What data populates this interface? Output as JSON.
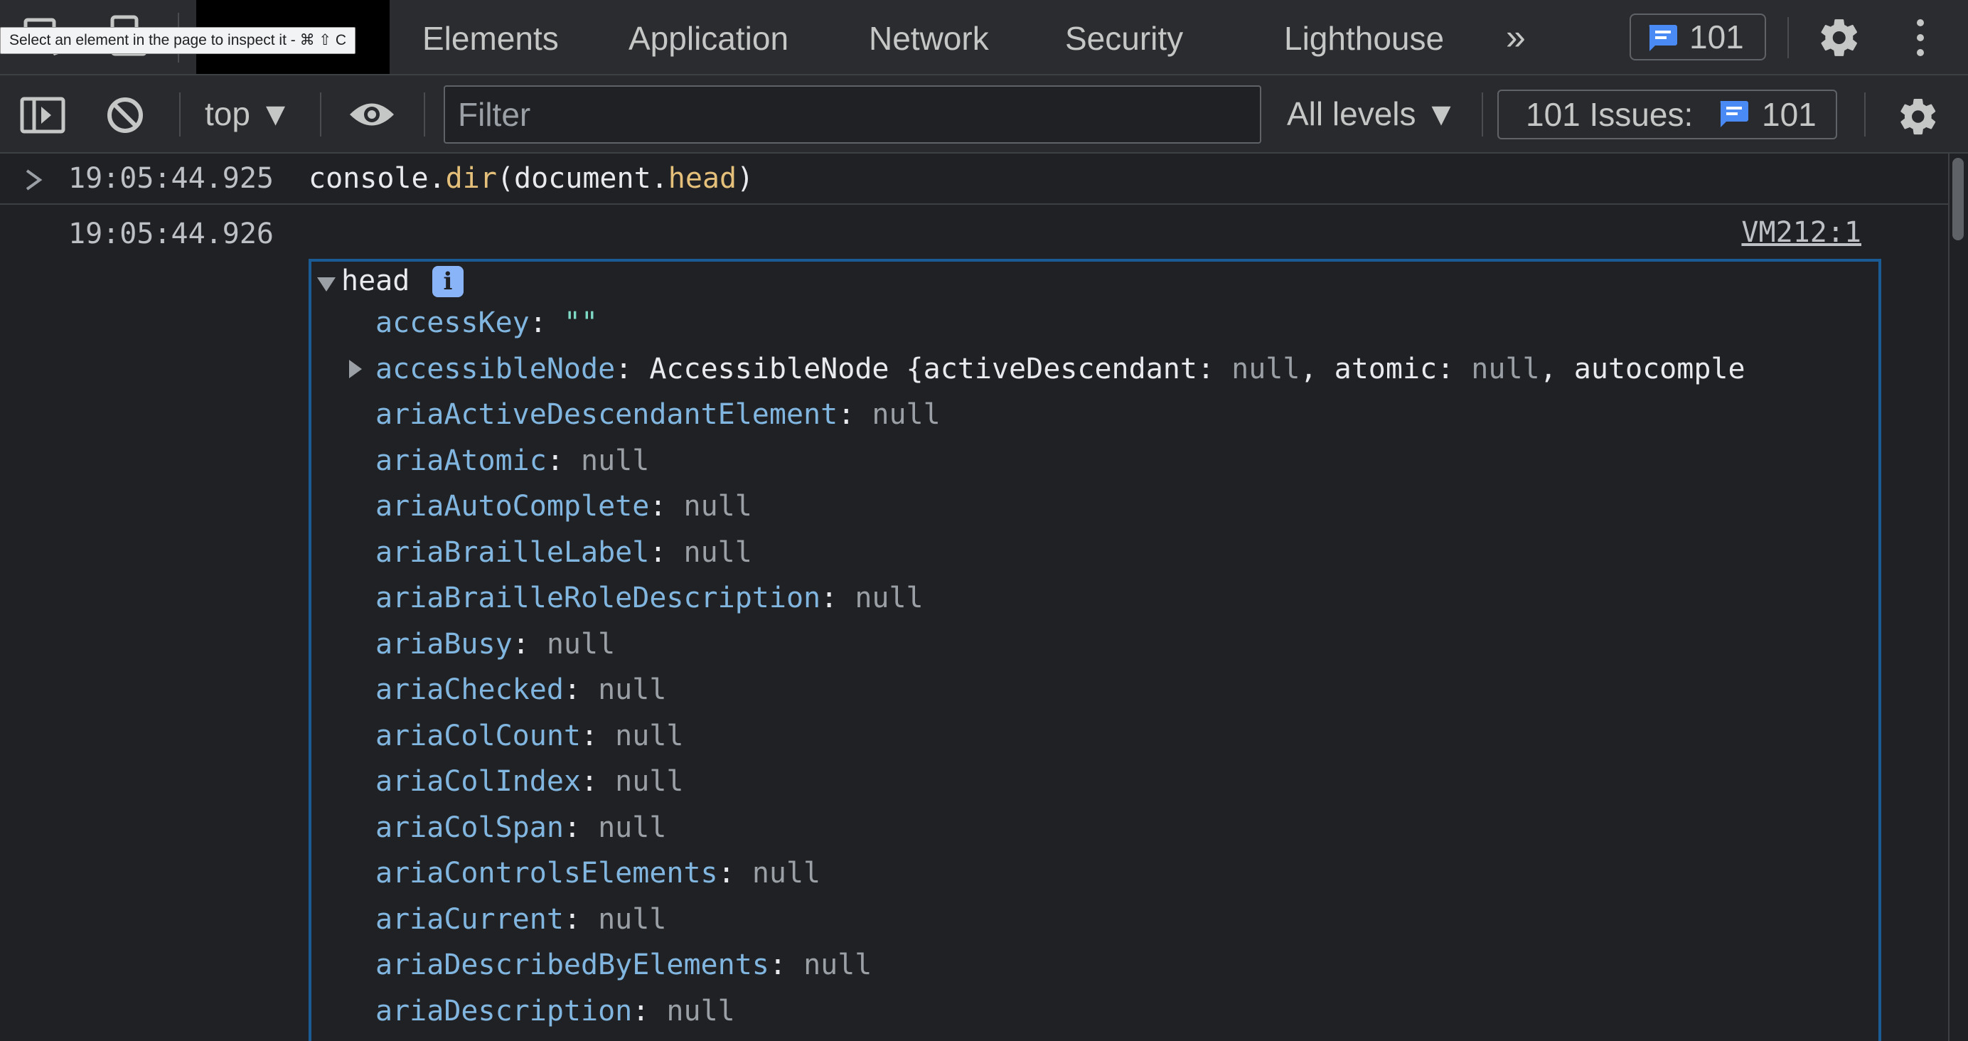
{
  "tooltip": {
    "text": "Select an element in the page to inspect it - ⌘ ⇧ C"
  },
  "tabs": [
    {
      "label": "Elements"
    },
    {
      "label": "Application"
    },
    {
      "label": "Network"
    },
    {
      "label": "Security"
    },
    {
      "label": "Lighthouse"
    }
  ],
  "tabbar": {
    "more_tabs": "»",
    "issues_count": "101"
  },
  "toolbar": {
    "context": "top ▼",
    "filter_placeholder": "Filter",
    "levels": "All levels ▼",
    "issues_label": "101 Issues:",
    "issues_count": "101"
  },
  "console": {
    "input": {
      "timestamp": "19:05:44.925",
      "cmd_pre": "console.",
      "cmd_fn": "dir",
      "cmd_mid": "(document.",
      "cmd_prop": "head",
      "cmd_end": ")"
    },
    "output": {
      "timestamp": "19:05:44.926",
      "source": "VM212:1",
      "object_name": "head",
      "info_badge": "i",
      "properties": [
        {
          "key": "accessKey",
          "value": "\"\"",
          "kind": "string"
        },
        {
          "key": "accessibleNode",
          "value": "AccessibleNode {activeDescendant: null, atomic: null, autocomple",
          "kind": "object"
        },
        {
          "key": "ariaActiveDescendantElement",
          "value": "null",
          "kind": "null"
        },
        {
          "key": "ariaAtomic",
          "value": "null",
          "kind": "null"
        },
        {
          "key": "ariaAutoComplete",
          "value": "null",
          "kind": "null"
        },
        {
          "key": "ariaBrailleLabel",
          "value": "null",
          "kind": "null"
        },
        {
          "key": "ariaBrailleRoleDescription",
          "value": "null",
          "kind": "null"
        },
        {
          "key": "ariaBusy",
          "value": "null",
          "kind": "null"
        },
        {
          "key": "ariaChecked",
          "value": "null",
          "kind": "null"
        },
        {
          "key": "ariaColCount",
          "value": "null",
          "kind": "null"
        },
        {
          "key": "ariaColIndex",
          "value": "null",
          "kind": "null"
        },
        {
          "key": "ariaColSpan",
          "value": "null",
          "kind": "null"
        },
        {
          "key": "ariaControlsElements",
          "value": "null",
          "kind": "null"
        },
        {
          "key": "ariaCurrent",
          "value": "null",
          "kind": "null"
        },
        {
          "key": "ariaDescribedByElements",
          "value": "null",
          "kind": "null"
        },
        {
          "key": "ariaDescription",
          "value": "null",
          "kind": "null"
        }
      ]
    }
  },
  "colors": {
    "accent": "#1a73e8",
    "selection_border": "#1a5a95",
    "key": "#81b6e0",
    "string": "#7ed9c5",
    "null": "#9aa0a6",
    "fn": "#e5c07b"
  }
}
